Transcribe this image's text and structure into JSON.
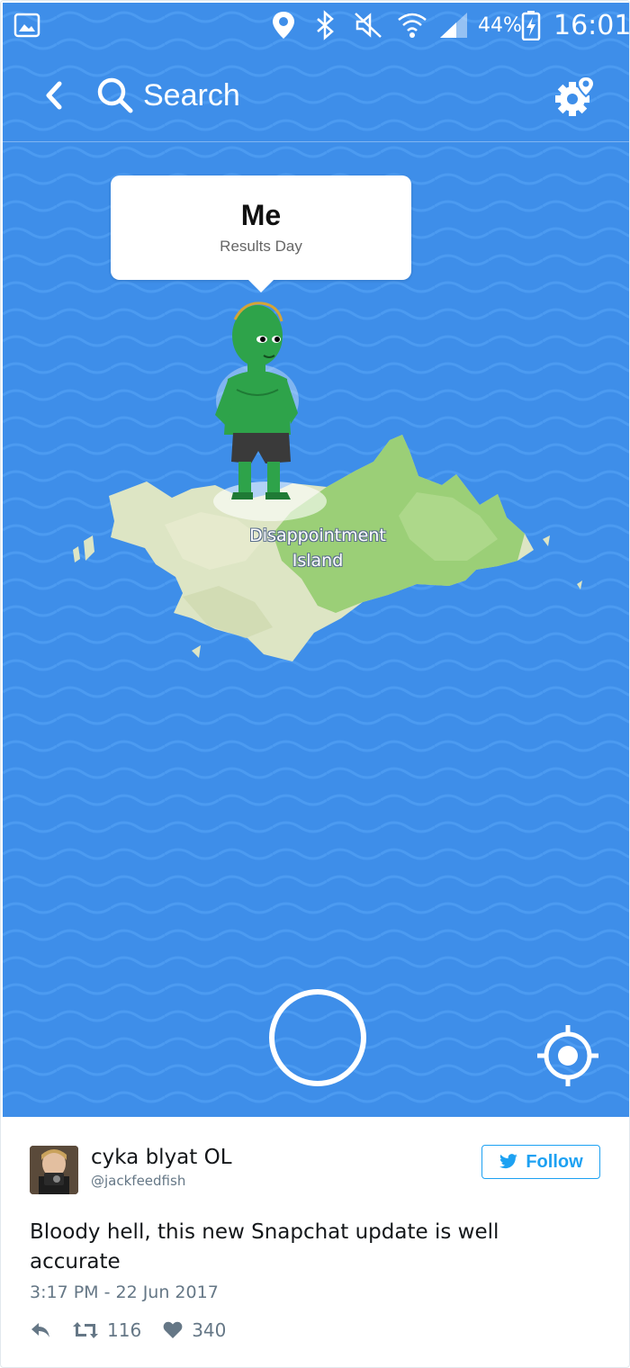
{
  "status_bar": {
    "battery": "44%",
    "time": "16:01"
  },
  "header": {
    "search_label": "Search"
  },
  "map": {
    "bubble": {
      "name": "Me",
      "status": "Results Day"
    },
    "island_label": [
      "Disappointment",
      "Island"
    ]
  },
  "tweet": {
    "user_name": "cyka blyat OL",
    "user_handle": "@jackfeedfish",
    "follow_label": "Follow",
    "text": "Bloody hell, this new Snapchat update is well accurate",
    "timestamp": "3:17 PM - 22 Jun 2017",
    "retweets": "116",
    "likes": "340"
  },
  "icons": {
    "status_bar": [
      "gallery-icon",
      "location-pin-icon",
      "bluetooth-icon",
      "mute-icon",
      "wifi-icon",
      "signal-icon",
      "battery-charging-icon"
    ],
    "header": [
      "back-icon",
      "search-icon",
      "settings-icon"
    ],
    "tweet_actions": [
      "reply-icon",
      "retweet-icon",
      "heart-icon"
    ]
  },
  "colors": {
    "map_water": "#3e8ee9",
    "wave_line": "#4a9af0",
    "island_light": "#dbe3c2",
    "island_green": "#7fc25e",
    "bitmoji_skin": "#2ea34a",
    "twitter_blue": "#1da1f2",
    "text_primary": "#14171a",
    "text_secondary": "#657786"
  }
}
